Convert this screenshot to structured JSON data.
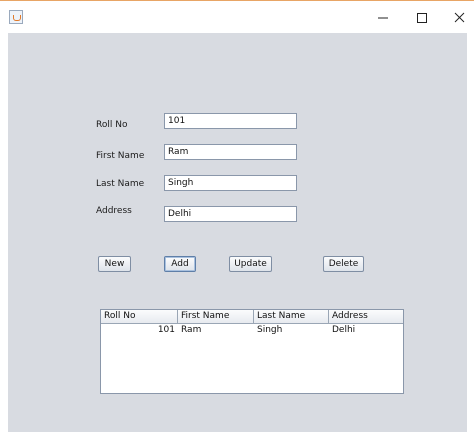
{
  "titlebar": {
    "icons": {
      "app": "java-cup-icon",
      "minimize": "minimize-icon",
      "maximize": "maximize-icon",
      "close": "close-icon"
    }
  },
  "form": {
    "roll_no": {
      "label": "Roll No",
      "value": "101"
    },
    "first_name": {
      "label": "First Name",
      "value": "Ram"
    },
    "last_name": {
      "label": "Last Name",
      "value": "Singh"
    },
    "address": {
      "label": "Address",
      "value": "Delhi"
    }
  },
  "buttons": {
    "new": "New",
    "add": "Add",
    "update": "Update",
    "delete": "Delete"
  },
  "table": {
    "columns": [
      "Roll No",
      "First Name",
      "Last Name",
      "Address"
    ],
    "rows": [
      [
        "101",
        "Ram",
        "Singh",
        "Delhi"
      ]
    ]
  },
  "colors": {
    "panel_background": "#d8dbe1",
    "titlebar_accent": "#e8a565"
  }
}
